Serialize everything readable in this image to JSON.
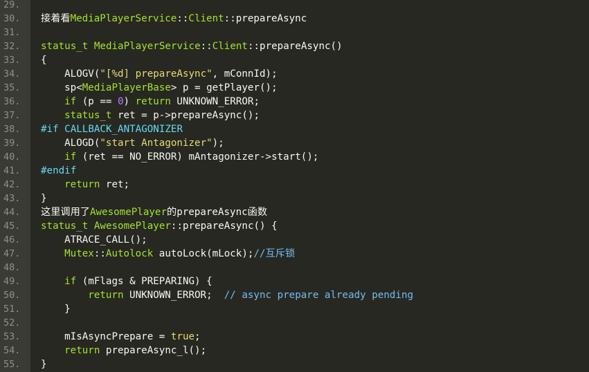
{
  "colors": {
    "background": "#272822",
    "gutter": "#3a3b35",
    "line_number": "#8f908a",
    "text": "#f8f8f2",
    "type": "#a6e22e",
    "keyword": "#f92672",
    "number": "#ae81ff",
    "string": "#e6db74",
    "preprocessor": "#66d9ef",
    "comment": "#75bdf0",
    "boolean": "#e6db74"
  },
  "lines": [
    {
      "number": "29.",
      "indent": 0,
      "tokens": []
    },
    {
      "number": "30.",
      "indent": 0,
      "tokens": [
        {
          "text": "接着看",
          "type": "text"
        },
        {
          "text": "MediaPlayerService",
          "type": "type"
        },
        {
          "text": "::",
          "type": "text"
        },
        {
          "text": "Client",
          "type": "type"
        },
        {
          "text": "::prepareAsync",
          "type": "text"
        }
      ]
    },
    {
      "number": "31.",
      "indent": 0,
      "tokens": []
    },
    {
      "number": "32.",
      "indent": 0,
      "tokens": [
        {
          "text": "status_t MediaPlayerService",
          "type": "type"
        },
        {
          "text": "::",
          "type": "text"
        },
        {
          "text": "Client",
          "type": "type"
        },
        {
          "text": "::prepareAsync()",
          "type": "text"
        }
      ]
    },
    {
      "number": "33.",
      "indent": 0,
      "tokens": [
        {
          "text": "{",
          "type": "text"
        }
      ]
    },
    {
      "number": "34.",
      "indent": 4,
      "tokens": [
        {
          "text": "ALOGV(",
          "type": "text"
        },
        {
          "text": "\"[%d] prepareAsync\"",
          "type": "string"
        },
        {
          "text": ", mConnId);",
          "type": "text"
        }
      ]
    },
    {
      "number": "35.",
      "indent": 4,
      "tokens": [
        {
          "text": "sp<",
          "type": "text"
        },
        {
          "text": "MediaPlayerBase",
          "type": "type"
        },
        {
          "text": "> p = getPlayer();",
          "type": "text"
        }
      ]
    },
    {
      "number": "36.",
      "indent": 4,
      "tokens": [
        {
          "text": "if",
          "type": "type"
        },
        {
          "text": " (p == ",
          "type": "text"
        },
        {
          "text": "0",
          "type": "number"
        },
        {
          "text": ") ",
          "type": "text"
        },
        {
          "text": "return",
          "type": "type"
        },
        {
          "text": " UNKNOWN_ERROR;",
          "type": "text"
        }
      ]
    },
    {
      "number": "37.",
      "indent": 4,
      "tokens": [
        {
          "text": "status_t",
          "type": "type"
        },
        {
          "text": " ret = p->prepareAsync();",
          "type": "text"
        }
      ]
    },
    {
      "number": "38.",
      "indent": 0,
      "tokens": [
        {
          "text": "#if CALLBACK_ANTAGONIZER",
          "type": "preprocessor"
        }
      ]
    },
    {
      "number": "39.",
      "indent": 4,
      "tokens": [
        {
          "text": "ALOGD(",
          "type": "text"
        },
        {
          "text": "\"start Antagonizer\"",
          "type": "string"
        },
        {
          "text": ");",
          "type": "text"
        }
      ]
    },
    {
      "number": "40.",
      "indent": 4,
      "tokens": [
        {
          "text": "if",
          "type": "type"
        },
        {
          "text": " (ret == NO_ERROR) mAntagonizer->start();",
          "type": "text"
        }
      ]
    },
    {
      "number": "41.",
      "indent": 0,
      "tokens": [
        {
          "text": "#endif",
          "type": "preprocessor"
        }
      ]
    },
    {
      "number": "42.",
      "indent": 4,
      "tokens": [
        {
          "text": "return",
          "type": "type"
        },
        {
          "text": " ret;",
          "type": "text"
        }
      ]
    },
    {
      "number": "43.",
      "indent": 0,
      "tokens": [
        {
          "text": "}",
          "type": "text"
        }
      ]
    },
    {
      "number": "44.",
      "indent": 0,
      "tokens": [
        {
          "text": "这里调用了",
          "type": "text"
        },
        {
          "text": "AwesomePlayer",
          "type": "type"
        },
        {
          "text": "的prepareAsync函数",
          "type": "text"
        }
      ]
    },
    {
      "number": "45.",
      "indent": 0,
      "tokens": [
        {
          "text": "status_t AwesomePlayer",
          "type": "type"
        },
        {
          "text": "::prepareAsync() {",
          "type": "text"
        }
      ]
    },
    {
      "number": "46.",
      "indent": 4,
      "tokens": [
        {
          "text": "ATRACE_CALL();",
          "type": "text"
        }
      ]
    },
    {
      "number": "47.",
      "indent": 4,
      "tokens": [
        {
          "text": "Mutex",
          "type": "type"
        },
        {
          "text": "::",
          "type": "text"
        },
        {
          "text": "Autolock",
          "type": "type"
        },
        {
          "text": " autoLock(mLock);",
          "type": "text"
        },
        {
          "text": "//互斥锁",
          "type": "comment"
        }
      ]
    },
    {
      "number": "48.",
      "indent": 0,
      "tokens": []
    },
    {
      "number": "49.",
      "indent": 4,
      "tokens": [
        {
          "text": "if",
          "type": "type"
        },
        {
          "text": " (mFlags & PREPARING) {",
          "type": "text"
        }
      ]
    },
    {
      "number": "50.",
      "indent": 8,
      "tokens": [
        {
          "text": "return",
          "type": "type"
        },
        {
          "text": " UNKNOWN_ERROR;  ",
          "type": "text"
        },
        {
          "text": "// async prepare already pending",
          "type": "comment"
        }
      ]
    },
    {
      "number": "51.",
      "indent": 4,
      "tokens": [
        {
          "text": "}",
          "type": "text"
        }
      ]
    },
    {
      "number": "52.",
      "indent": 0,
      "tokens": []
    },
    {
      "number": "53.",
      "indent": 4,
      "tokens": [
        {
          "text": "mIsAsyncPrepare = ",
          "type": "text"
        },
        {
          "text": "true",
          "type": "boolean"
        },
        {
          "text": ";",
          "type": "text"
        }
      ]
    },
    {
      "number": "54.",
      "indent": 4,
      "tokens": [
        {
          "text": "return",
          "type": "type"
        },
        {
          "text": " prepareAsync_l();",
          "type": "text"
        }
      ]
    },
    {
      "number": "55.",
      "indent": 0,
      "tokens": [
        {
          "text": "}",
          "type": "text"
        }
      ]
    }
  ]
}
